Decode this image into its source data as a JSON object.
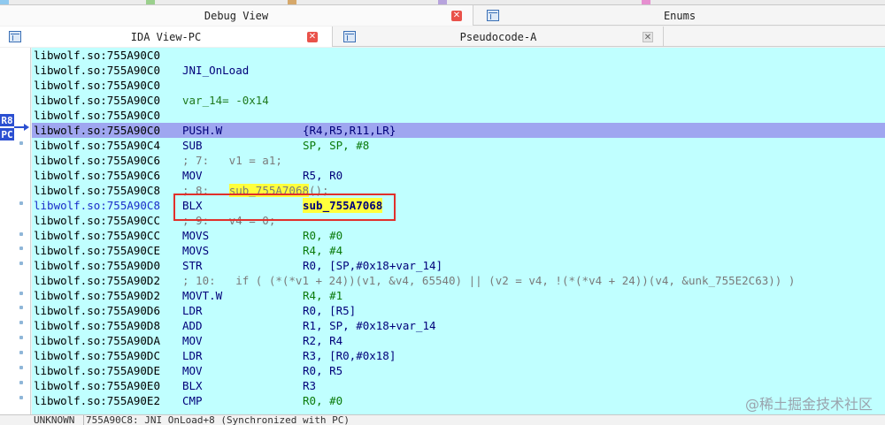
{
  "tabs_top": {
    "debug_view": "Debug View",
    "enums": "Enums"
  },
  "tabs_second": {
    "ida_view": "IDA View-PC",
    "pseudocode": "Pseudocode-A"
  },
  "gutter": {
    "reg_r8": "R8",
    "reg_pc": "PC"
  },
  "listing": [
    {
      "addr": "libwolf.so:755A90C0"
    },
    {
      "addr": "libwolf.so:755A90C0",
      "label": "JNI_OnLoad"
    },
    {
      "addr": "libwolf.so:755A90C0"
    },
    {
      "addr": "libwolf.so:755A90C0",
      "var": "var_14= -0x14"
    },
    {
      "addr": "libwolf.so:755A90C0"
    },
    {
      "addr": "libwolf.so:755A90C0",
      "mnem": "PUSH.W",
      "ops": "{R4,R5,R11,LR}"
    },
    {
      "addr": "libwolf.so:755A90C4",
      "mnem": "SUB",
      "ops": "SP, SP, #8"
    },
    {
      "addr": "libwolf.so:755A90C6",
      "comment": "; 7:   v1 = a1;"
    },
    {
      "addr": "libwolf.so:755A90C6",
      "mnem": "MOV",
      "ops": "R5, R0"
    },
    {
      "addr": "libwolf.so:755A90C8",
      "comment_pre": "; 8:   ",
      "comment_hl": "sub_755A7068",
      "comment_post": "();"
    },
    {
      "addr": "libwolf.so:755A90C8",
      "mnem": "BLX",
      "ops": "sub_755A7068"
    },
    {
      "addr": "libwolf.so:755A90CC",
      "comment": "; 9:   v4 = 0;"
    },
    {
      "addr": "libwolf.so:755A90CC",
      "mnem": "MOVS",
      "ops": "R0, #0"
    },
    {
      "addr": "libwolf.so:755A90CE",
      "mnem": "MOVS",
      "ops": "R4, #4"
    },
    {
      "addr": "libwolf.so:755A90D0",
      "mnem": "STR",
      "ops": "R0, [SP,#0x18+var_14]"
    },
    {
      "addr": "libwolf.so:755A90D2",
      "comment": "; 10:   if ( (*(*v1 + 24))(v1, &v4, 65540) || (v2 = v4, !(*(*v4 + 24))(v4, &unk_755E2C63)) )"
    },
    {
      "addr": "libwolf.so:755A90D2",
      "mnem": "MOVT.W",
      "ops": "R4, #1"
    },
    {
      "addr": "libwolf.so:755A90D6",
      "mnem": "LDR",
      "ops": "R0, [R5]"
    },
    {
      "addr": "libwolf.so:755A90D8",
      "mnem": "ADD",
      "ops": "R1, SP, #0x18+var_14"
    },
    {
      "addr": "libwolf.so:755A90DA",
      "mnem": "MOV",
      "ops": "R2, R4"
    },
    {
      "addr": "libwolf.so:755A90DC",
      "mnem": "LDR",
      "ops": "R3, [R0,#0x18]"
    },
    {
      "addr": "libwolf.so:755A90DE",
      "mnem": "MOV",
      "ops": "R0, R5"
    },
    {
      "addr": "libwolf.so:755A90E0",
      "mnem": "BLX",
      "ops": "R3"
    },
    {
      "addr": "libwolf.so:755A90E2",
      "mnem": "CMP",
      "ops": "R0, #0"
    }
  ],
  "status": {
    "mode": "UNKNOWN",
    "location": "755A90C8: JNI_OnLoad+8 (Synchronized with PC)"
  },
  "watermark": "@稀土掘金技术社区",
  "colors": {
    "listing_bg": "#c0ffff",
    "pc_line": "#9fa6f0",
    "highlight": "#ffff3c",
    "annotation_box": "#e0302a"
  }
}
